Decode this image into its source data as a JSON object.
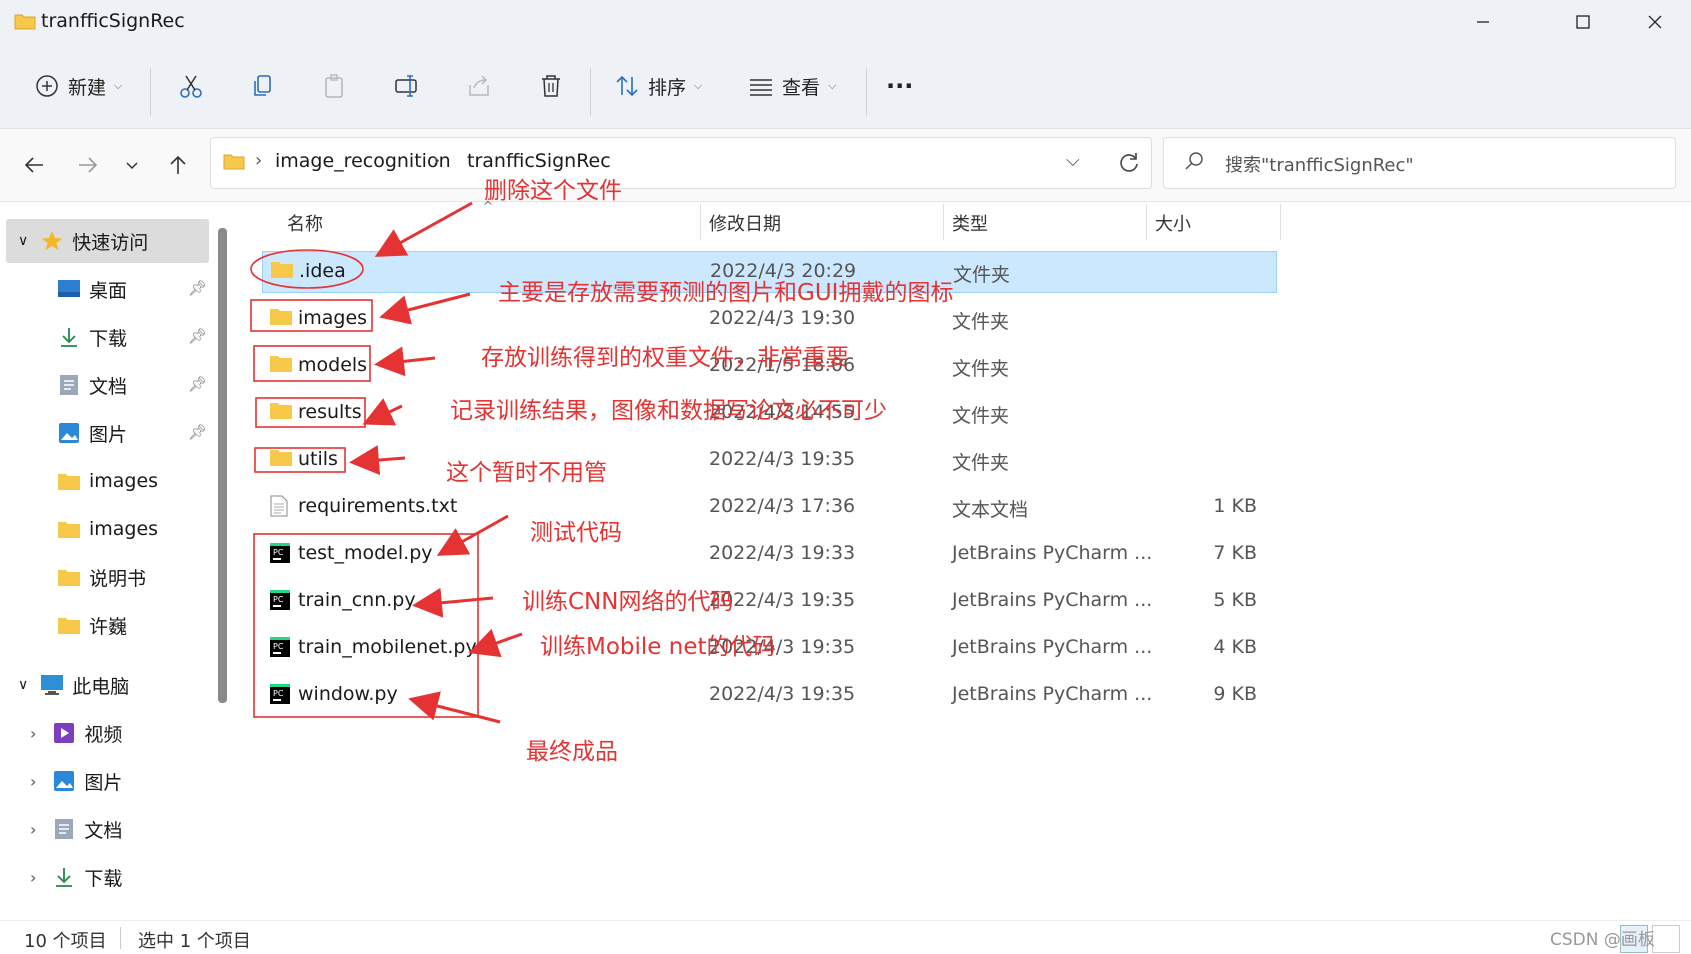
{
  "window": {
    "title": "tranfficSignRec",
    "controls": [
      "minimize",
      "maximize",
      "close"
    ]
  },
  "toolbar": {
    "new_label": "新建",
    "sort_label": "排序",
    "view_label": "查看",
    "more_label": "···"
  },
  "address": {
    "crumbs": [
      "image_recognition",
      "tranfficSignRec"
    ],
    "search_placeholder": "搜索\"tranfficSignRec\""
  },
  "sidebar": {
    "quick_access": "快速访问",
    "pinned": [
      "桌面",
      "下载",
      "文档",
      "图片"
    ],
    "recent": [
      "images",
      "images",
      "说明书",
      "许巍"
    ],
    "this_pc": "此电脑",
    "pc_items": [
      "视频",
      "图片",
      "文档",
      "下载"
    ]
  },
  "columns": [
    "名称",
    "修改日期",
    "类型",
    "大小"
  ],
  "files": [
    {
      "name": ".idea",
      "date": "2022/4/3 20:29",
      "type": "文件夹",
      "size": "",
      "icon": "folder-icon",
      "selected": true
    },
    {
      "name": "images",
      "date": "2022/4/3 19:30",
      "type": "文件夹",
      "size": "",
      "icon": "folder-icon"
    },
    {
      "name": "models",
      "date": "2022/1/5 18:06",
      "type": "文件夹",
      "size": "",
      "icon": "folder-icon"
    },
    {
      "name": "results",
      "date": "2022/4/3 14:55",
      "type": "文件夹",
      "size": "",
      "icon": "folder-icon"
    },
    {
      "name": "utils",
      "date": "2022/4/3 19:35",
      "type": "文件夹",
      "size": "",
      "icon": "folder-icon"
    },
    {
      "name": "requirements.txt",
      "date": "2022/4/3 17:36",
      "type": "文本文档",
      "size": "1 KB",
      "icon": "text-file-icon"
    },
    {
      "name": "test_model.py",
      "date": "2022/4/3 19:33",
      "type": "JetBrains PyCharm ...",
      "size": "7 KB",
      "icon": "pycharm-file-icon"
    },
    {
      "name": "train_cnn.py",
      "date": "2022/4/3 19:35",
      "type": "JetBrains PyCharm ...",
      "size": "5 KB",
      "icon": "pycharm-file-icon"
    },
    {
      "name": "train_mobilenet.py",
      "date": "2022/4/3 19:35",
      "type": "JetBrains PyCharm ...",
      "size": "4 KB",
      "icon": "pycharm-file-icon"
    },
    {
      "name": "window.py",
      "date": "2022/4/3 19:35",
      "type": "JetBrains PyCharm ...",
      "size": "9 KB",
      "icon": "pycharm-file-icon"
    }
  ],
  "status": {
    "item_count": "10 个项目",
    "selection": "选中 1 个项目"
  },
  "annotations": {
    "delete": "删除这个文件",
    "images": "主要是存放需要预测的图片和GUI拥戴的图标",
    "models": "存放训练得到的权重文件，非常重要",
    "results": "记录训练结果，图像和数据写论文必不可少",
    "utils": "这个暂时不用管",
    "test": "测试代码",
    "cnn": "训练CNN网络的代码",
    "mobilenet": "训练Mobile net的代码",
    "final": "最终成品"
  },
  "watermark": "CSDN @画板",
  "colors": {
    "annotation": "#e53333",
    "selection_bg": "#cce8ff",
    "folder": "#f8c84a",
    "pycharm_accent": "#21d789"
  }
}
